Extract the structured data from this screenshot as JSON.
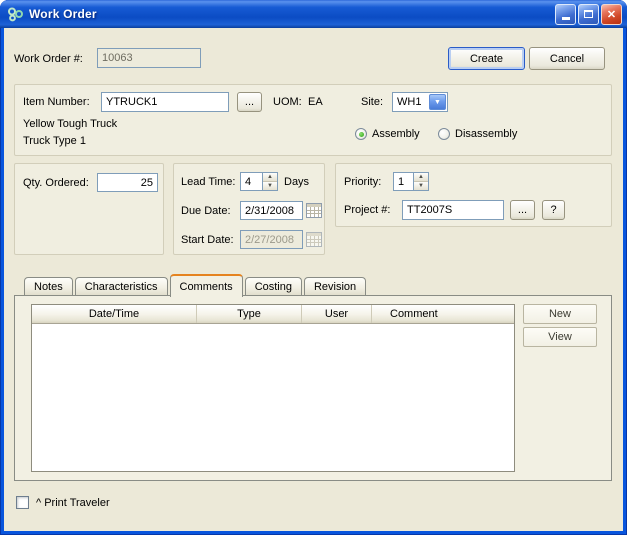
{
  "colors": {
    "titlebar_blue": "#0B4CC4",
    "dialog_bg": "#ECE9D8",
    "accent_orange": "#E5831F",
    "field_border": "#7F9DB9",
    "close_red": "#C33D20",
    "radio_selected_green": "#27A012"
  },
  "icons": {
    "spin_up": "▲",
    "spin_down": "▼",
    "dropdown": "▼",
    "close": "✕"
  },
  "window": {
    "title": "Work Order"
  },
  "header": {
    "work_order_label": "Work Order #:",
    "work_order_value": "10063",
    "create_button": "Create",
    "cancel_button": "Cancel"
  },
  "item": {
    "item_number_label": "Item Number:",
    "item_number_value": "YTRUCK1",
    "item_browse_button": "...",
    "uom_label": "UOM:",
    "uom_value": "EA",
    "site_label": "Site:",
    "site_value": "WH1",
    "description_line1": "Yellow Tough Truck",
    "description_line2": "Truck Type 1",
    "assembly_label": "Assembly",
    "assembly_selected": true,
    "disassembly_label": "Disassembly",
    "disassembly_selected": false
  },
  "quantity": {
    "qty_label": "Qty. Ordered:",
    "qty_value": "25"
  },
  "schedule": {
    "lead_time_label": "Lead Time:",
    "lead_time_value": "4",
    "days_label": "Days",
    "due_date_label": "Due Date:",
    "due_date_value": "2/31/2008",
    "start_date_label": "Start Date:",
    "start_date_value": "2/27/2008",
    "start_date_disabled": true
  },
  "priority": {
    "priority_label": "Priority:",
    "priority_value": "1",
    "project_label": "Project #:",
    "project_value": "TT2007S",
    "project_browse_button": "...",
    "project_help_button": "?"
  },
  "tabs": [
    {
      "label": "Notes"
    },
    {
      "label": "Characteristics"
    },
    {
      "label": "Comments"
    },
    {
      "label": "Costing"
    },
    {
      "label": "Revision"
    }
  ],
  "active_tab": "Comments",
  "comments_tab": {
    "columns": [
      "Date/Time",
      "Type",
      "User",
      "Comment"
    ],
    "rows": [],
    "new_button": "New",
    "view_button": "View"
  },
  "footer": {
    "print_traveler_label": "^ Print Traveler",
    "print_traveler_checked": false
  }
}
